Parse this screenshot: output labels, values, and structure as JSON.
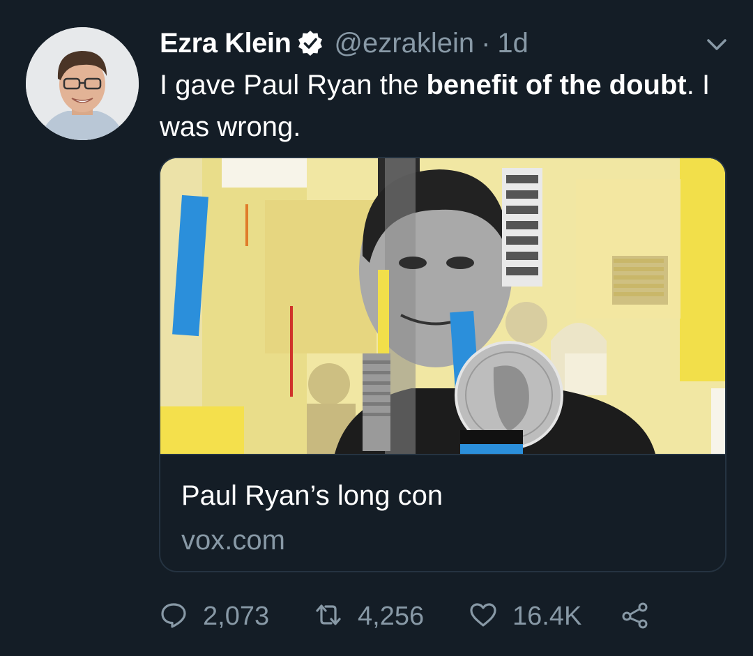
{
  "tweet": {
    "author_name": "Ezra Klein",
    "handle": "@ezraklein",
    "separator": "·",
    "time": "1d",
    "text_part1": "I gave Paul Ryan the ",
    "text_bold1": "benefit of the doubt",
    "text_part2": ". I was wrong.",
    "card": {
      "title": "Paul Ryan’s long con",
      "domain": "vox.com"
    },
    "actions": {
      "replies": "2,073",
      "retweets": "4,256",
      "likes": "16.4K"
    }
  },
  "colors": {
    "background": "#141d26",
    "secondary_text": "#8899a6",
    "card_border": "#253341",
    "verified_badge": "#ffffff"
  },
  "icons": [
    "verified-icon",
    "chevron-down-icon",
    "reply-icon",
    "retweet-icon",
    "like-icon",
    "share-icon"
  ]
}
